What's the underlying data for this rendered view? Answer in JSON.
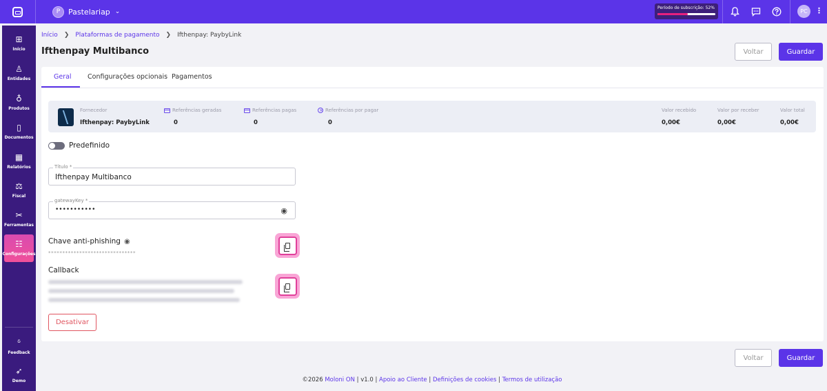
{
  "topbar": {
    "company_initial": "P",
    "company_name": "Pastelariap",
    "subscription_label": "Período de subscrição: 52%",
    "subscription_progress": 0.52,
    "user_initials": "PC"
  },
  "sidebar": {
    "items": [
      {
        "label": "Início",
        "icon": "⊞"
      },
      {
        "label": "Entidades",
        "icon": "♙"
      },
      {
        "label": "Produtos",
        "icon": "♁"
      },
      {
        "label": "Documentos",
        "icon": "▯"
      },
      {
        "label": "Relatórios",
        "icon": "▦"
      },
      {
        "label": "Fiscal",
        "icon": "⚖"
      },
      {
        "label": "Ferramentas",
        "icon": "✂"
      },
      {
        "label": "Configurações",
        "icon": "☷"
      }
    ],
    "bottom": [
      {
        "label": "Feedback",
        "icon": "ᵟ"
      },
      {
        "label": "Demo",
        "icon": "➶"
      }
    ]
  },
  "breadcrumb": {
    "home": "Início",
    "payments": "Plataformas de pagamento",
    "current": "Ifthenpay: PaybyLink"
  },
  "page_title": "Ifthenpay Multibanco",
  "buttons": {
    "back": "Voltar",
    "save": "Guardar",
    "disable": "Desativar"
  },
  "tabs": [
    "Geral",
    "Configurações opcionais",
    "Pagamentos"
  ],
  "stats": {
    "provider_label": "Fornecedor",
    "provider_name": "Ifthenpay: PaybyLink",
    "refs_generated_label": "Referências geradas",
    "refs_generated_value": "0",
    "refs_paid_label": "Referências pagas",
    "refs_paid_value": "0",
    "refs_unpaid_label": "Referências por pagar",
    "refs_unpaid_value": "0",
    "received_label": "Valor recebido",
    "received_value": "0,00€",
    "to_receive_label": "Valor por receber",
    "to_receive_value": "0,00€",
    "total_label": "Valor total",
    "total_value": "0,00€"
  },
  "form": {
    "default_toggle_label": "Predefinido",
    "title_label": "Título *",
    "title_value": "Ifthenpay Multibanco",
    "gateway_label": "gatewayKey *",
    "gateway_value": "•••••••••••",
    "antiphishing_label": "Chave anti-phishing",
    "antiphishing_masked": "*******************************",
    "callback_label": "Callback"
  },
  "footer": {
    "copyright": "©2026 ",
    "brand": "Moloni ON",
    "version": " | v1.0 | ",
    "support": "Apoio ao Cliente",
    "sep1": " | ",
    "cookies": "Definições de cookies",
    "sep2": " | ",
    "terms": "Termos de utilização"
  }
}
